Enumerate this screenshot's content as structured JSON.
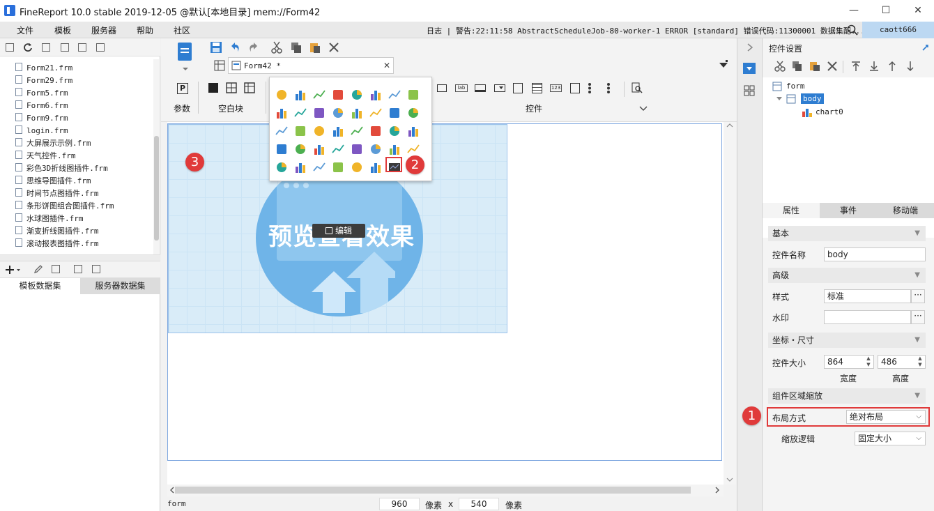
{
  "window": {
    "title": "FineReport 10.0 stable 2019-12-05 @默认[本地目录]    mem://Form42",
    "min": "—",
    "max": "☐",
    "close": "✕"
  },
  "menu": {
    "items": [
      "文件",
      "模板",
      "服务器",
      "帮助",
      "社区"
    ],
    "log_text": "日志 | 警告:22:11:58 AbstractScheduleJob-80-worker-1 ERROR [standard] 错误代码:11300001 数据集配...",
    "user": "caott666"
  },
  "left": {
    "files": [
      "Form21.frm",
      "Form29.frm",
      "Form5.frm",
      "Form6.frm",
      "Form9.frm",
      "login.frm",
      "大屏展示示例.frm",
      "天气控件.frm",
      "彩色3D折线图插件.frm",
      "思维导图插件.frm",
      "时间节点图插件.frm",
      "条形饼图组合图插件.frm",
      "水球图插件.frm",
      "渐变折线图插件.frm",
      "滚动报表图插件.frm"
    ],
    "tabs": [
      "模板数据集",
      "服务器数据集"
    ]
  },
  "center": {
    "tab_label": "Form42 *",
    "sections": {
      "param": "参数",
      "blank": "空白块",
      "controls": "控件"
    },
    "control_lab": "lab",
    "control_123": "123",
    "preview_text": "预览查看效果",
    "edit_label": "编辑",
    "status": {
      "name": "form",
      "width": "960",
      "unit1": "像素",
      "x": "x",
      "height": "540",
      "unit2": "像素"
    }
  },
  "right": {
    "title": "控件设置",
    "tree": {
      "root": "form",
      "body": "body",
      "chart": "chart0"
    },
    "tabs": [
      "属性",
      "事件",
      "移动端"
    ],
    "sections": {
      "basic": "基本",
      "advanced": "高级",
      "coords": "坐标・尺寸",
      "scale": "组件区域缩放"
    },
    "fields": {
      "name_label": "控件名称",
      "name_value": "body",
      "style_label": "样式",
      "style_value": "标准",
      "watermark_label": "水印",
      "watermark_value": "",
      "size_label": "控件大小",
      "width_value": "864",
      "height_value": "486",
      "width_caption": "宽度",
      "height_caption": "高度",
      "layout_label": "布局方式",
      "layout_value": "绝对布局",
      "zoom_label": "缩放逻辑",
      "zoom_value": "固定大小"
    }
  },
  "callouts": [
    "1",
    "2",
    "3"
  ],
  "colors": {
    "accent": "#2a6fdb",
    "callout": "#e03a3a",
    "selection": "#7fa8e0"
  }
}
